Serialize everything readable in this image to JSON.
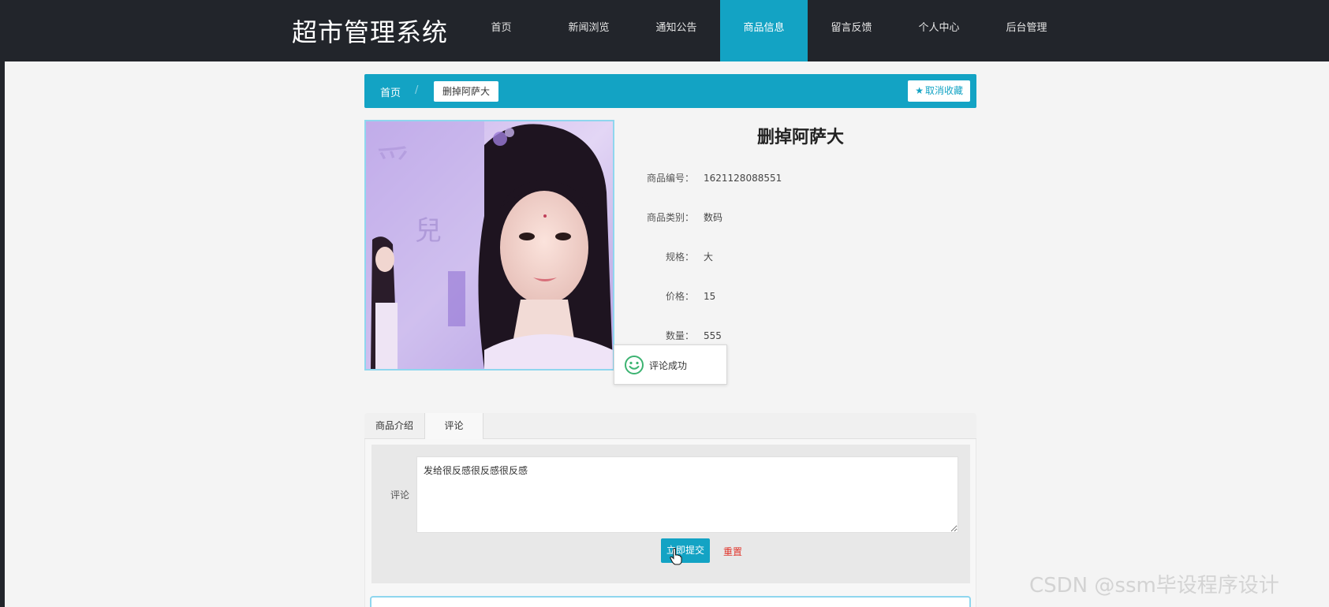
{
  "app": {
    "title": "超市管理系统"
  },
  "nav": {
    "items": [
      {
        "label": "首页"
      },
      {
        "label": "新闻浏览"
      },
      {
        "label": "通知公告"
      },
      {
        "label": "商品信息"
      },
      {
        "label": "留言反馈"
      },
      {
        "label": "个人中心"
      },
      {
        "label": "后台管理"
      }
    ],
    "active_index": 3
  },
  "breadcrumb": {
    "home": "首页",
    "separator": "/",
    "current": "删掉阿萨大"
  },
  "favorite": {
    "label": "取消收藏",
    "icon": "star-icon"
  },
  "product": {
    "image_icon": "product-photo",
    "title": "删掉阿萨大",
    "fields": [
      {
        "label": "商品编号：",
        "value": "1621128088551"
      },
      {
        "label": "商品类别：",
        "value": "数码"
      },
      {
        "label": "规格：",
        "value": "大"
      },
      {
        "label": "价格：",
        "value": "15"
      },
      {
        "label": "数量：",
        "value": "555"
      }
    ]
  },
  "toast": {
    "icon": "smile-icon",
    "message": "评论成功"
  },
  "tabs": [
    {
      "label": "商品介绍"
    },
    {
      "label": "评论"
    }
  ],
  "comment_form": {
    "label": "评论",
    "value": "发给很反感很反感很反感",
    "submit_label": "立即提交",
    "reset_label": "重置"
  },
  "watermark": "CSDN @ssm毕设程序设计",
  "colors": {
    "accent": "#13a3c4",
    "topbar": "#22252b",
    "reset": "#e0352b"
  }
}
